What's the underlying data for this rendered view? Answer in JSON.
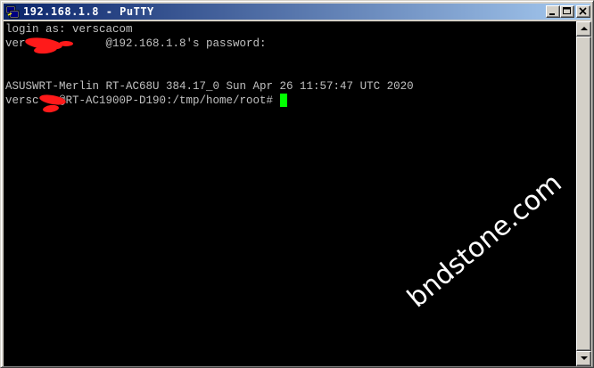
{
  "window": {
    "title": "192.168.1.8 - PuTTY"
  },
  "icons": {
    "app": "putty-app-icon",
    "minimize": "minimize-icon",
    "maximize": "maximize-icon",
    "close": "close-icon"
  },
  "terminal": {
    "lines": [
      "login as: verscacom",
      "ver            @192.168.1.8's password:",
      "ASUSWRT-Merlin RT-AC68U 384.17_0 Sun Apr 26 11:57:47 UTC 2020",
      "versc  m@RT-AC1900P-D190:/tmp/home/root# "
    ],
    "text_color": "#c0c0c0",
    "background": "#000000",
    "cursor_color": "#00ff00"
  },
  "watermark": "bndstone.com",
  "colors": {
    "titlebar_start": "#0a246a",
    "titlebar_end": "#a6caf0",
    "redaction": "#ff1a1a"
  }
}
